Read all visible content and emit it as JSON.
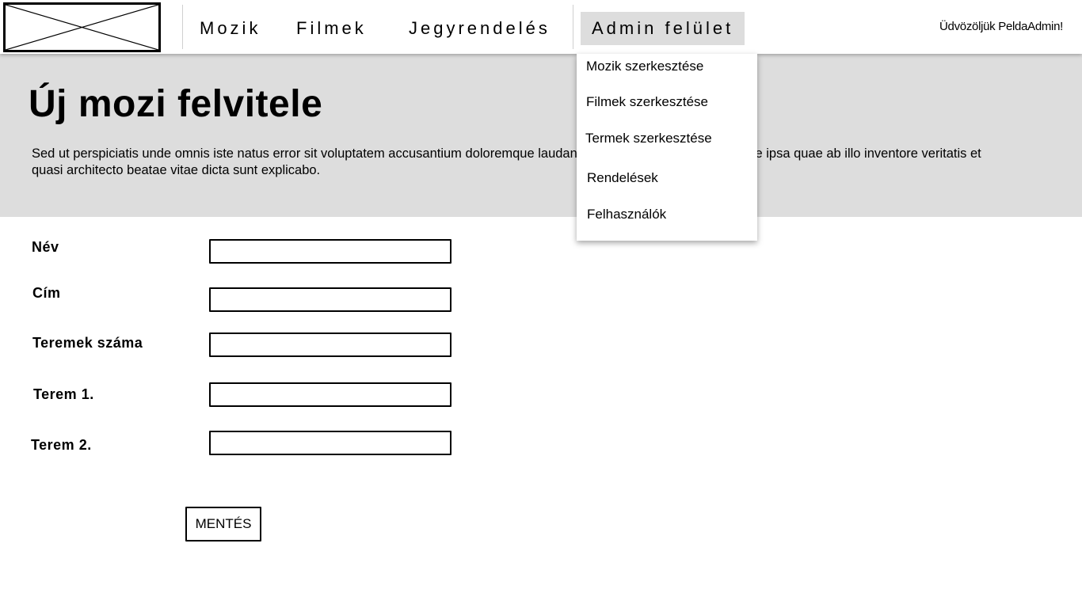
{
  "header": {
    "logo": {
      "icon": "image-placeholder-icon"
    },
    "nav": {
      "movies": "Mozik",
      "films": "Filmek",
      "tickets": "Jegyrendelés",
      "admin": "Admin felület"
    },
    "welcome": "Üdvözöljük PeldaAdmin!"
  },
  "dropdown": {
    "items": [
      "Mozik szerkesztése",
      "Filmek szerkesztése",
      "Termek szerkesztése",
      "Rendelések",
      "Felhasználók"
    ]
  },
  "hero": {
    "title": "Új mozi felvitele",
    "text": "Sed ut perspiciatis unde omnis iste natus error sit voluptatem accusantium doloremque laudantium, totam rem aperiam, eaque ipsa quae ab illo inventore veritatis et quasi architecto beatae vitae dicta sunt explicabo."
  },
  "form": {
    "fields": [
      {
        "label": "Név",
        "value": ""
      },
      {
        "label": "Cím",
        "value": ""
      },
      {
        "label": "Teremek száma",
        "value": ""
      },
      {
        "label": "Terem 1.",
        "value": ""
      },
      {
        "label": "Terem 2.",
        "value": ""
      }
    ],
    "save_label": "MENTÉS"
  },
  "colors": {
    "hero_background": "#dddddd",
    "active_nav_background": "#dddddd",
    "border": "#000000"
  }
}
